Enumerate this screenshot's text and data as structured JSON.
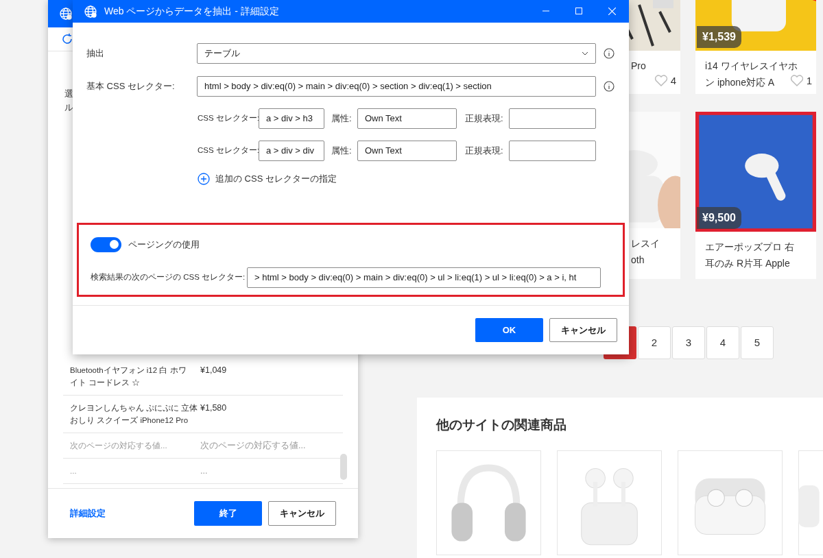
{
  "browser": {
    "cards": [
      {
        "title_lines": [
          "Pro"
        ],
        "likes": "4"
      },
      {
        "price": "¥1,539",
        "title_lines": [
          "i14 ワイヤレスイヤホ",
          "ン iphone対応 A"
        ],
        "likes": "1"
      },
      {
        "title_lines": [
          "レスイ",
          "oth"
        ]
      },
      {
        "price": "¥9,500",
        "title_lines": [
          "エアーポッズプロ 右",
          "耳のみ R片耳 Apple"
        ]
      }
    ],
    "pagination": [
      {
        "selected": true
      },
      {
        "label": "2",
        "selected": false
      },
      {
        "label": "3",
        "selected": false
      },
      {
        "label": "4",
        "selected": false
      },
      {
        "label": "5",
        "selected": false
      }
    ],
    "related": {
      "title": "他のサイトの関連商品"
    }
  },
  "left_panel": {
    "description": [
      "選",
      "ル"
    ],
    "rows": [
      {
        "kind": "value",
        "name_lines": [
          "Bluetoothイヤフォン i12 白 ホワ",
          "イト コードレス ☆"
        ],
        "price": "¥1,049"
      },
      {
        "kind": "value",
        "name_lines": [
          "クレヨンしんちゃん ぷにぷに 立体",
          "おしり スクイーズ iPhone12 Pro"
        ],
        "price": "¥1,580"
      },
      {
        "kind": "placeholder",
        "name_lines": [
          "次のページの対応する値..."
        ],
        "price": "次のページの対応する値..."
      },
      {
        "kind": "placeholder",
        "name_lines": [
          "..."
        ],
        "price": "..."
      }
    ],
    "advanced_link": "詳細設定",
    "buttons": [
      {
        "label": "終了",
        "kind": "primary"
      },
      {
        "label": "キャンセル",
        "kind": "secondary"
      }
    ]
  },
  "dialog": {
    "title": "Web ページからデータを抽出 - 詳細設定",
    "extract": {
      "label": "抽出",
      "value": "テーブル"
    },
    "base_selector": {
      "label": "基本 CSS セレクター:",
      "value": "html > body > div:eq(0) > main > div:eq(0) > section > div:eq(1) > section"
    },
    "selectors": [
      {
        "selector_label": "CSS セレクター:",
        "selector": "a > div > h3",
        "attribute_label": "属性:",
        "attribute": "Own Text",
        "regex_label": "正規表現:"
      },
      {
        "selector_label": "CSS セレクター:",
        "selector": "a > div > div",
        "attribute_label": "属性:",
        "attribute": "Own Text",
        "regex_label": "正規表現:"
      }
    ],
    "add_selector": "追加の CSS セレクターの指定",
    "paging": {
      "label": "ページングの使用",
      "on": true,
      "next_label": "検索結果の次のページの CSS セレクター:",
      "next_value": "> html > body > div:eq(0) > main > div:eq(0) > ul > li:eq(1) > ul > li:eq(0) > a > i, ht"
    },
    "buttons": [
      {
        "label": "OK",
        "kind": "primary"
      },
      {
        "label": "キャンセル",
        "kind": "secondary"
      }
    ]
  }
}
